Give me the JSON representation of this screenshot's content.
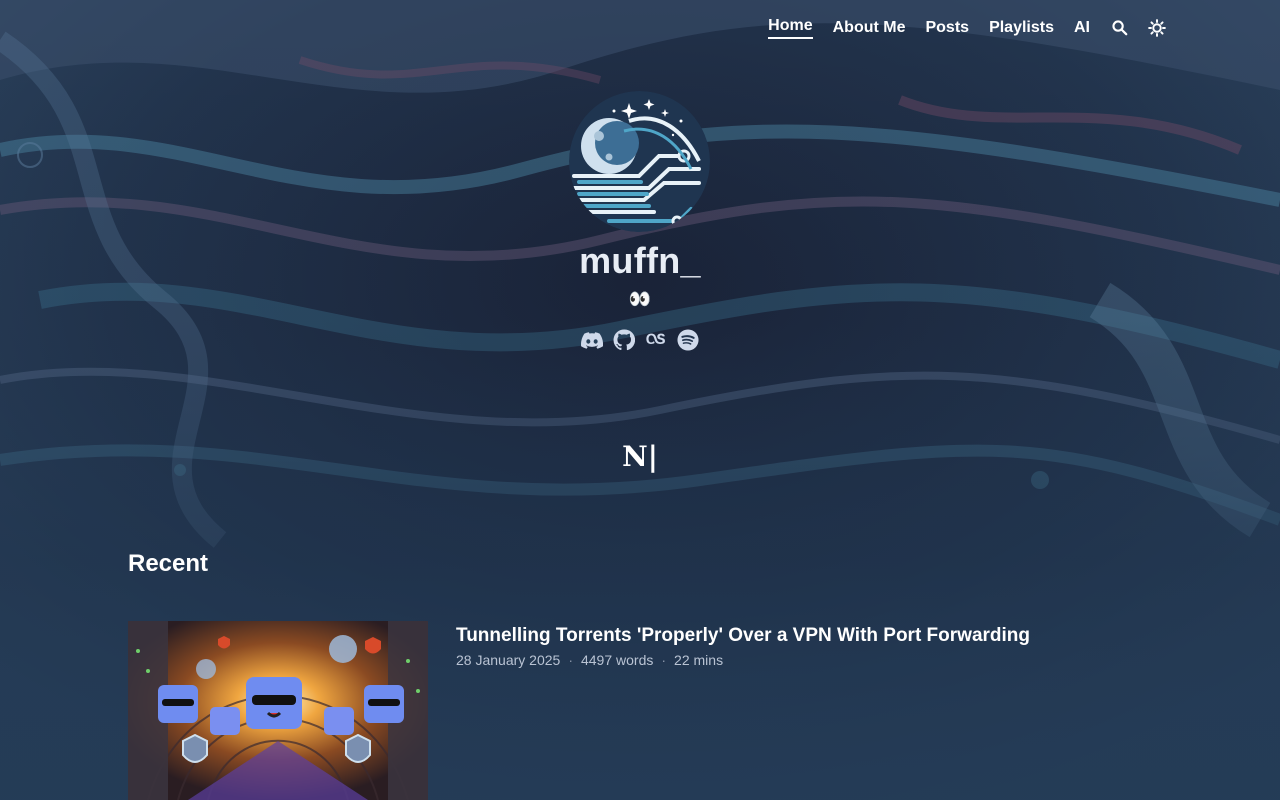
{
  "nav": {
    "items": [
      {
        "label": "Home",
        "active": true
      },
      {
        "label": "About Me",
        "active": false
      },
      {
        "label": "Posts",
        "active": false
      },
      {
        "label": "Playlists",
        "active": false
      },
      {
        "label": "AI",
        "active": false
      }
    ],
    "search_icon": "search-icon",
    "theme_icon": "sun-icon"
  },
  "profile": {
    "name": "muffn_",
    "tagline": "👀",
    "socials": [
      "discord-icon",
      "github-icon",
      "lastfm-icon",
      "spotify-icon"
    ]
  },
  "badge": {
    "text": "N|"
  },
  "recent": {
    "heading": "Recent",
    "posts": [
      {
        "title": "Tunnelling Torrents 'Properly' Over a VPN With Port Forwarding",
        "date": "28 January 2025",
        "words": "4497 words",
        "read_time": "22 mins",
        "separator": "·"
      }
    ]
  },
  "colors": {
    "background": "#1d2f45",
    "text": "#ffffff",
    "meta": "#b9c3d3"
  }
}
